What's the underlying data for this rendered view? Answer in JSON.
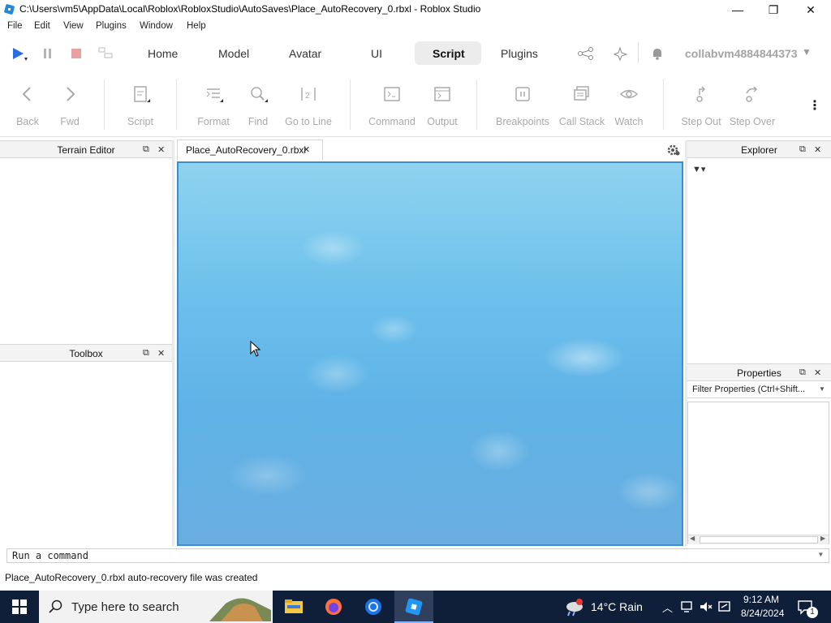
{
  "window": {
    "title": "C:\\Users\\vm5\\AppData\\Local\\Roblox\\RobloxStudio\\AutoSaves\\Place_AutoRecovery_0.rbxl - Roblox Studio",
    "minimize": "—",
    "maximize": "❐",
    "close": "✕"
  },
  "menu": [
    "File",
    "Edit",
    "View",
    "Plugins",
    "Window",
    "Help"
  ],
  "top_tabs": [
    "Home",
    "Model",
    "Avatar",
    "UI",
    "Script",
    "Plugins"
  ],
  "active_tab": "Script",
  "user": "collabvm4884844373",
  "ribbon": {
    "back": "Back",
    "fwd": "Fwd",
    "script": "Script",
    "format": "Format",
    "find": "Find",
    "goto": "Go to Line",
    "command": "Command",
    "output": "Output",
    "breakpoints": "Breakpoints",
    "callstack": "Call Stack",
    "watch": "Watch",
    "stepout": "Step Out",
    "stepover": "Step Over"
  },
  "panels": {
    "terrain": "Terrain Editor",
    "toolbox": "Toolbox",
    "explorer": "Explorer",
    "properties": "Properties",
    "filter_props": "Filter Properties (Ctrl+Shift..."
  },
  "doc_tab": "Place_AutoRecovery_0.rbxl",
  "command_bar": "Run a command",
  "status": "Place_AutoRecovery_0.rbxl auto-recovery file was created",
  "taskbar": {
    "search_placeholder": "Type here to search",
    "weather": "14°C  Rain",
    "time": "9:12 AM",
    "date": "8/24/2024",
    "notification_count": "1"
  },
  "colors": {
    "accent": "#3a8fcf",
    "taskbar": "#0f1f3a",
    "play": "#2a6de0",
    "stop": "#e07a7a"
  }
}
